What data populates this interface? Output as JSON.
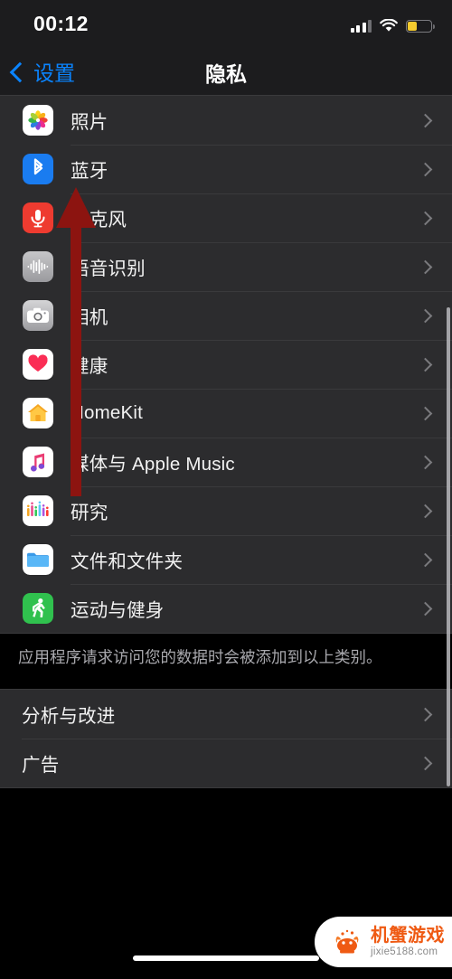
{
  "status_bar": {
    "time": "00:12",
    "signal_icon": "cellular-signal-icon",
    "signal_bars_filled": 3,
    "signal_bars_total": 4,
    "wifi_icon": "wifi-icon",
    "battery_icon": "battery-icon",
    "battery_percent": 38,
    "battery_color": "#f5cb2e"
  },
  "nav": {
    "back_label": "设置",
    "back_icon": "chevron-left-icon",
    "title": "隐私"
  },
  "privacy_section": {
    "rows": [
      {
        "label": "照片",
        "icon": "photos-icon",
        "chevron": "chevron-right-icon"
      },
      {
        "label": "蓝牙",
        "icon": "bluetooth-icon",
        "chevron": "chevron-right-icon"
      },
      {
        "label": "麦克风",
        "icon": "microphone-icon",
        "chevron": "chevron-right-icon"
      },
      {
        "label": "语音识别",
        "icon": "speech-recognition-icon",
        "chevron": "chevron-right-icon"
      },
      {
        "label": "相机",
        "icon": "camera-icon",
        "chevron": "chevron-right-icon"
      },
      {
        "label": "健康",
        "icon": "health-icon",
        "chevron": "chevron-right-icon"
      },
      {
        "label": "HomeKit",
        "icon": "homekit-icon",
        "chevron": "chevron-right-icon"
      },
      {
        "label": "媒体与 Apple Music",
        "icon": "music-icon",
        "chevron": "chevron-right-icon"
      },
      {
        "label": "研究",
        "icon": "research-icon",
        "chevron": "chevron-right-icon"
      },
      {
        "label": "文件和文件夹",
        "icon": "files-icon",
        "chevron": "chevron-right-icon"
      },
      {
        "label": "运动与健身",
        "icon": "fitness-icon",
        "chevron": "chevron-right-icon"
      }
    ],
    "footer_note": "应用程序请求访问您的数据时会被添加到以上类别。"
  },
  "extra_section": {
    "rows": [
      {
        "label": "分析与改进",
        "chevron": "chevron-right-icon"
      },
      {
        "label": "广告",
        "chevron": "chevron-right-icon"
      }
    ]
  },
  "annotation": {
    "arrow_icon": "up-arrow-annotation",
    "color": "#8c1410",
    "points_to": "蓝牙"
  },
  "watermark": {
    "logo_icon": "crab-logo-icon",
    "title": "机蟹游戏",
    "subtitle": "jixie5188.com"
  },
  "home_indicator": {
    "icon": "home-indicator"
  }
}
